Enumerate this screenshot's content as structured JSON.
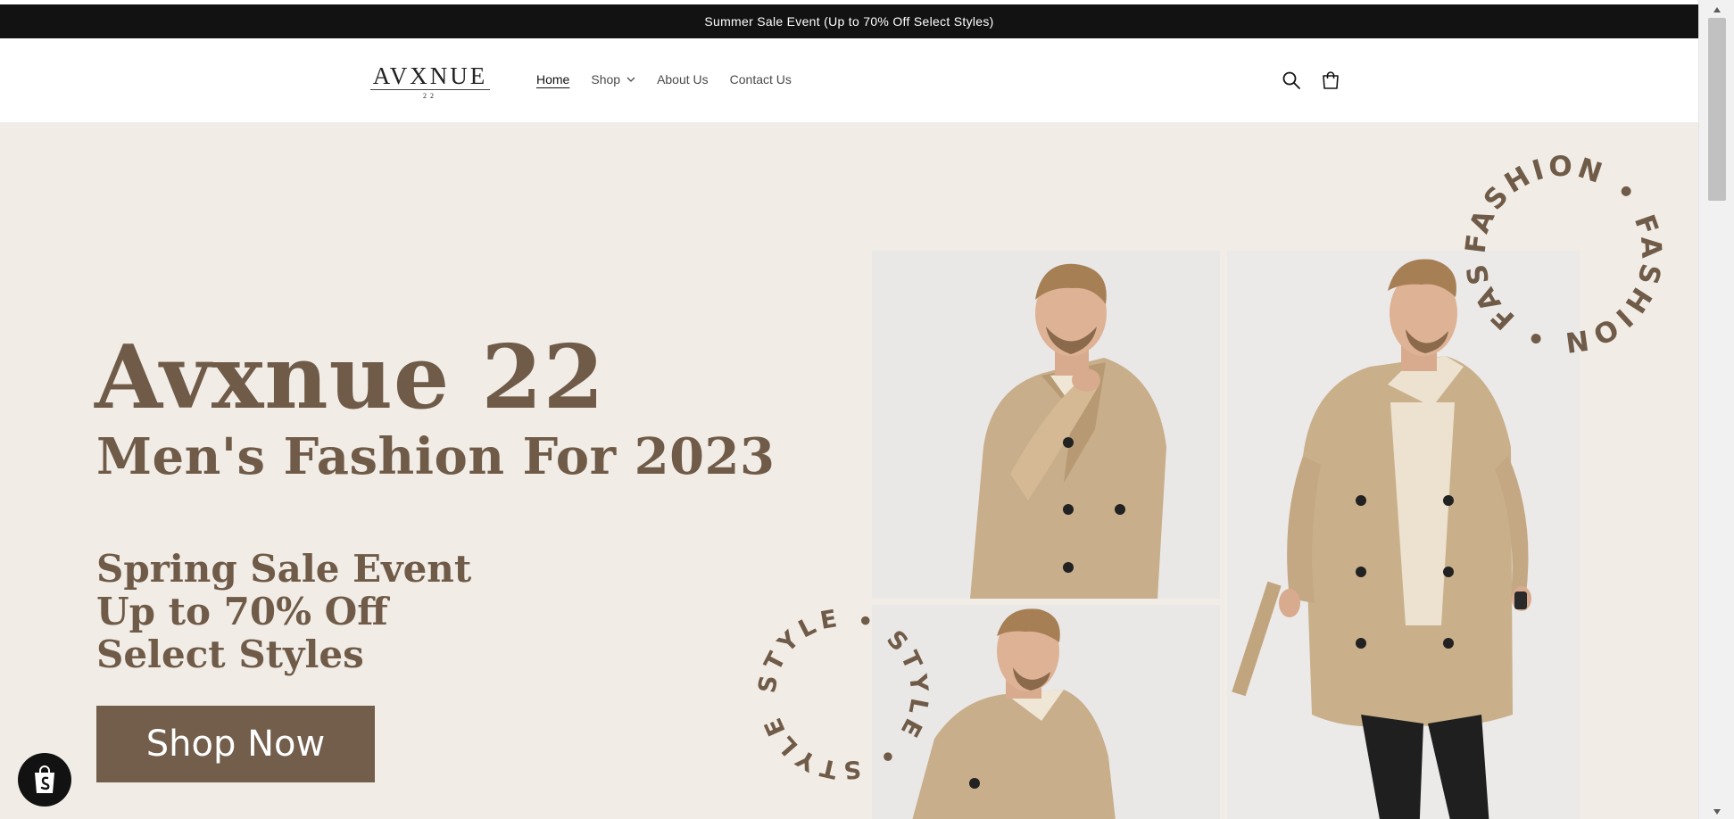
{
  "announcement": {
    "text": "Summer Sale Event (Up to 70% Off Select Styles)"
  },
  "header": {
    "logo_main": "AVXNUE",
    "logo_sub": "22",
    "nav": [
      {
        "label": "Home",
        "active": true
      },
      {
        "label": "Shop",
        "has_dropdown": true
      },
      {
        "label": "About Us"
      },
      {
        "label": "Contact Us"
      }
    ],
    "icons": [
      "search-icon",
      "cart-icon"
    ]
  },
  "hero": {
    "title": "Avxnue 22",
    "subtitle": "Men's Fashion For 2023",
    "sale_lines": [
      "Spring Sale Event",
      "Up to 70% Off",
      "Select Styles"
    ],
    "cta_label": "Shop Now",
    "badge_fashion": "FASHION • FASHION • FASHION •",
    "badge_style": "STYLE • STYLE • STYLE •"
  },
  "colors": {
    "announcement_bg": "#121212",
    "hero_bg": "#f1ede6",
    "brand_brown": "#6f5b48",
    "button_bg": "#735e4b"
  },
  "shopify_badge": {
    "icon": "shopify-bag-icon"
  }
}
